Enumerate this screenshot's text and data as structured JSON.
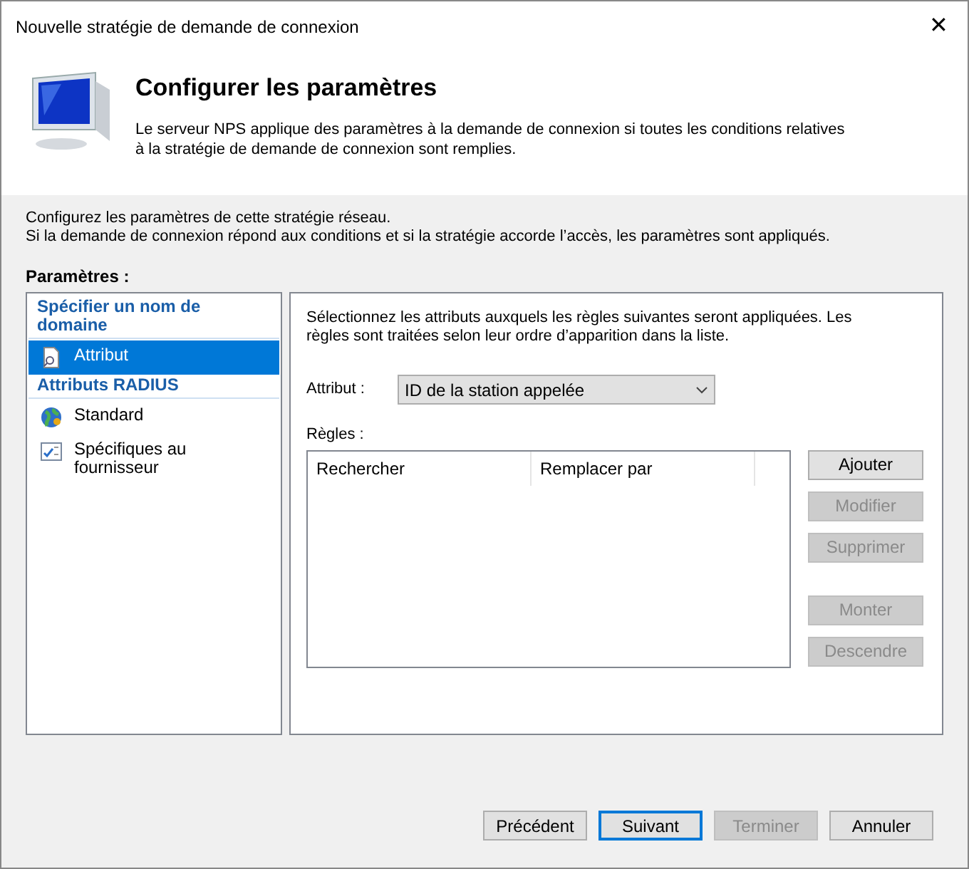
{
  "window": {
    "title": "Nouvelle stratégie de demande de connexion",
    "close": "✕"
  },
  "header": {
    "title": "Configurer les paramètres",
    "description": "Le serveur NPS applique des paramètres à la demande de connexion si toutes les conditions relatives à la stratégie de demande de connexion sont remplies."
  },
  "intro": [
    "Configurez les paramètres de cette stratégie réseau.",
    "Si la demande de connexion répond aux conditions et si la stratégie accorde l’accès, les paramètres sont appliqués."
  ],
  "settings_label": "Paramètres :",
  "sidebar": {
    "items": [
      {
        "kind": "group",
        "label": "Spécifier un nom de domaine"
      },
      {
        "kind": "item",
        "label": "Attribut",
        "selected": true
      },
      {
        "kind": "group",
        "label": "Attributs RADIUS"
      },
      {
        "kind": "item",
        "label": "Standard",
        "selected": false
      },
      {
        "kind": "item",
        "label": "Spécifiques au fournisseur",
        "selected": false
      }
    ]
  },
  "panel": {
    "description": "Sélectionnez les attributs auxquels les règles suivantes seront appliquées. Les règles sont traitées selon leur ordre d’apparition dans la liste.",
    "attribute_label": "Attribut :",
    "attribute_value": "ID de la station appelée",
    "rules_label": "Règles :",
    "table": {
      "columns": [
        "Rechercher",
        "Remplacer par"
      ]
    },
    "buttons": [
      {
        "label": "Ajouter",
        "disabled": false
      },
      {
        "label": "Modifier",
        "disabled": true
      },
      {
        "label": "Supprimer",
        "disabled": true
      },
      {
        "label": "Monter",
        "disabled": true
      },
      {
        "label": "Descendre",
        "disabled": true
      }
    ]
  },
  "footer": {
    "buttons": [
      {
        "label": "Précédent",
        "disabled": false,
        "default": false
      },
      {
        "label": "Suivant",
        "disabled": false,
        "default": true
      },
      {
        "label": "Terminer",
        "disabled": true,
        "default": false
      },
      {
        "label": "Annuler",
        "disabled": false,
        "default": false
      }
    ]
  }
}
